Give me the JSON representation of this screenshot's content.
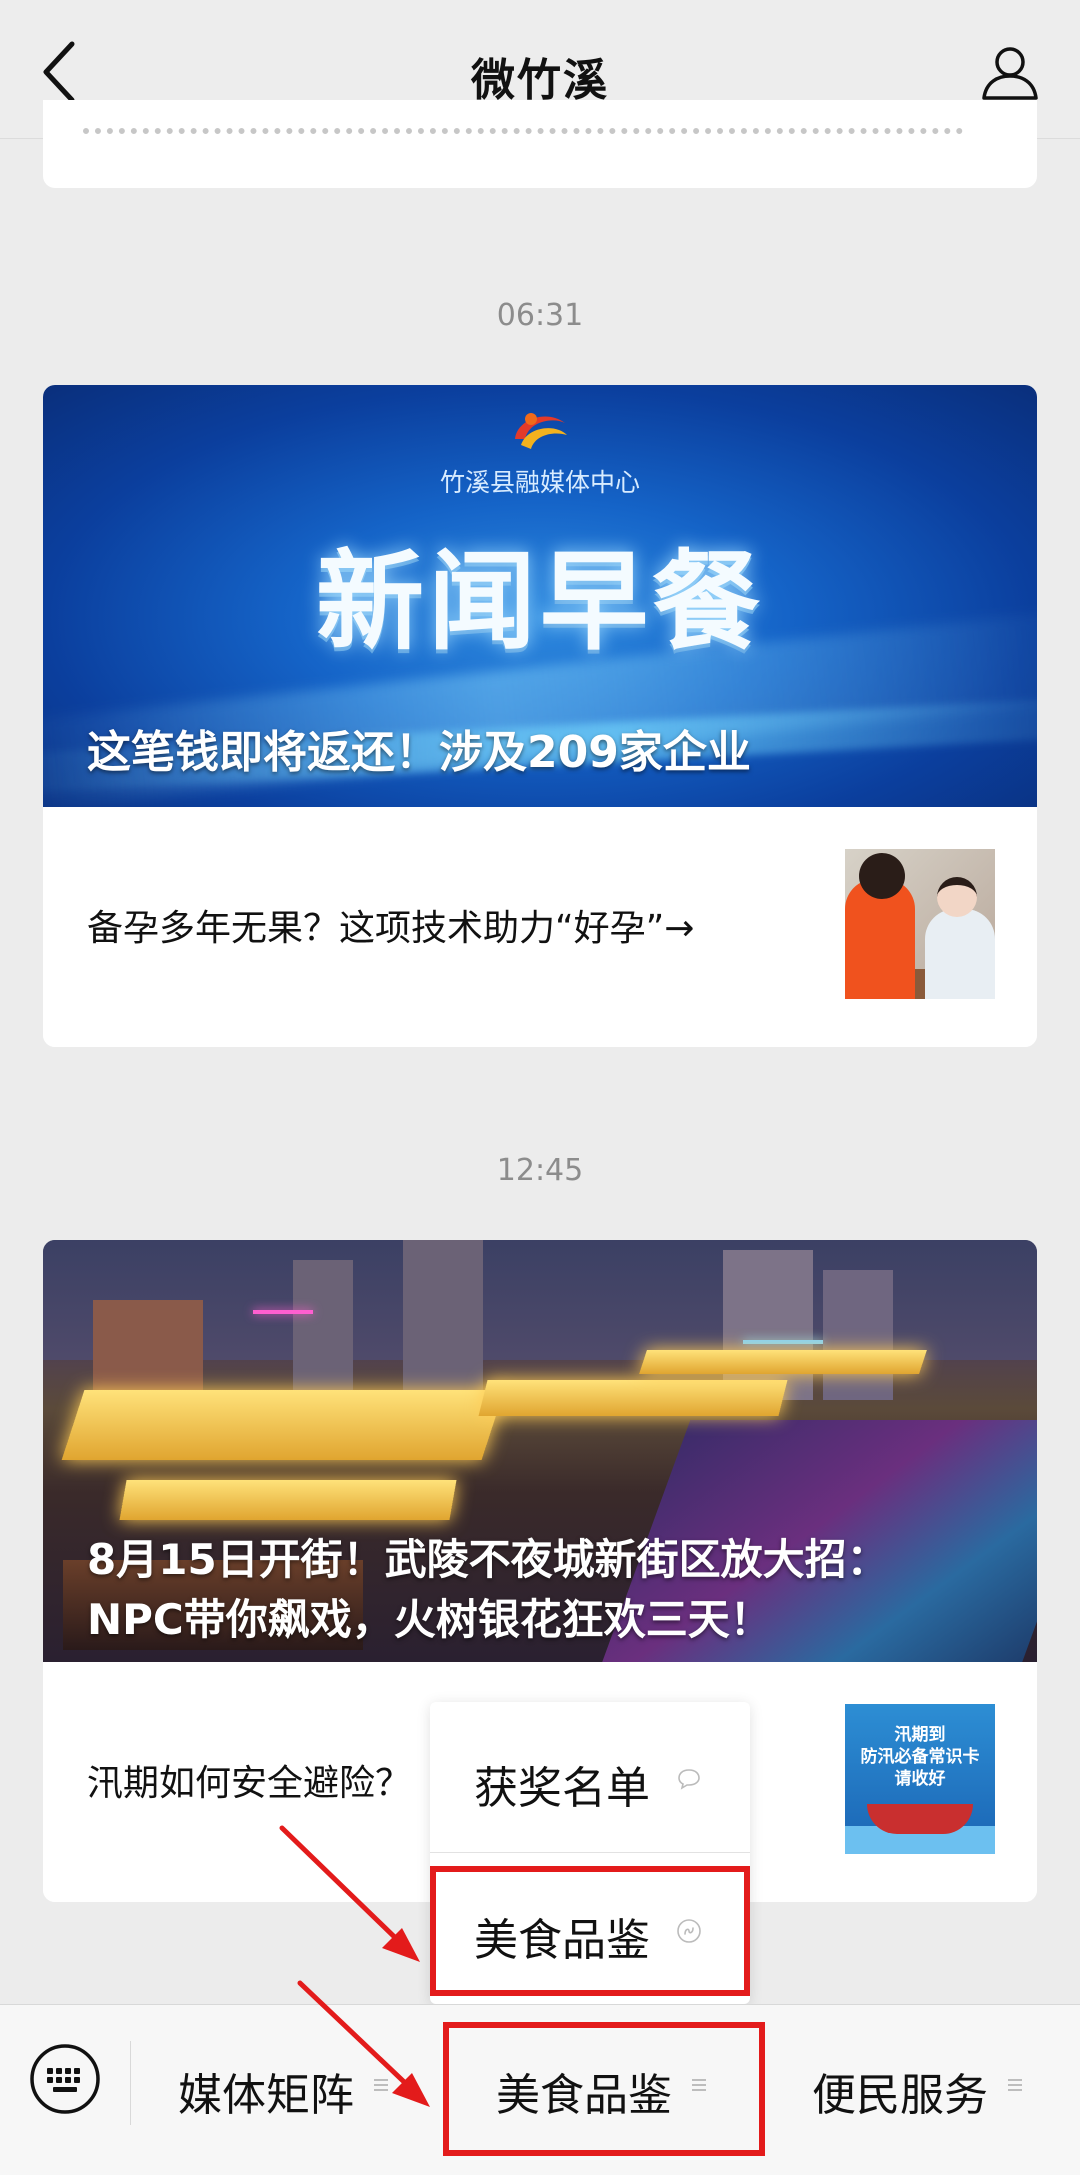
{
  "header": {
    "title": "微竹溪"
  },
  "feed": [
    {
      "time": "06:31",
      "banner_org": "竹溪县融媒体中心",
      "banner_title": "新闻早餐",
      "banner_caption": "这笔钱即将返还！涉及209家企业",
      "sub_title": "备孕多年无果？这项技术助力“好孕”→"
    },
    {
      "time": "12:45",
      "banner_caption_line1": "8月15日开街！武陵不夜城新街区放大招：",
      "banner_caption_line2": "NPC带你飙戏，火树银花狂欢三天！",
      "sub_title": "汛期如何安全避险？",
      "thumb_text": "汛期到\n防汛必备常识卡\n请收好"
    }
  ],
  "popup_menu": {
    "items": [
      {
        "label": "获奖名单",
        "icon": "message-icon"
      },
      {
        "label": "美食品鉴",
        "icon": "mini-program-icon"
      }
    ]
  },
  "bottom_menu": {
    "items": [
      {
        "label": "媒体矩阵",
        "icon": "menu-lines-icon"
      },
      {
        "label": "美食品鉴",
        "icon": "menu-lines-icon"
      },
      {
        "label": "便民服务",
        "icon": "menu-lines-icon"
      }
    ]
  },
  "colors": {
    "annotation_red": "#e31b1b",
    "background": "#ececec",
    "banner_blue": "#1564c8"
  }
}
